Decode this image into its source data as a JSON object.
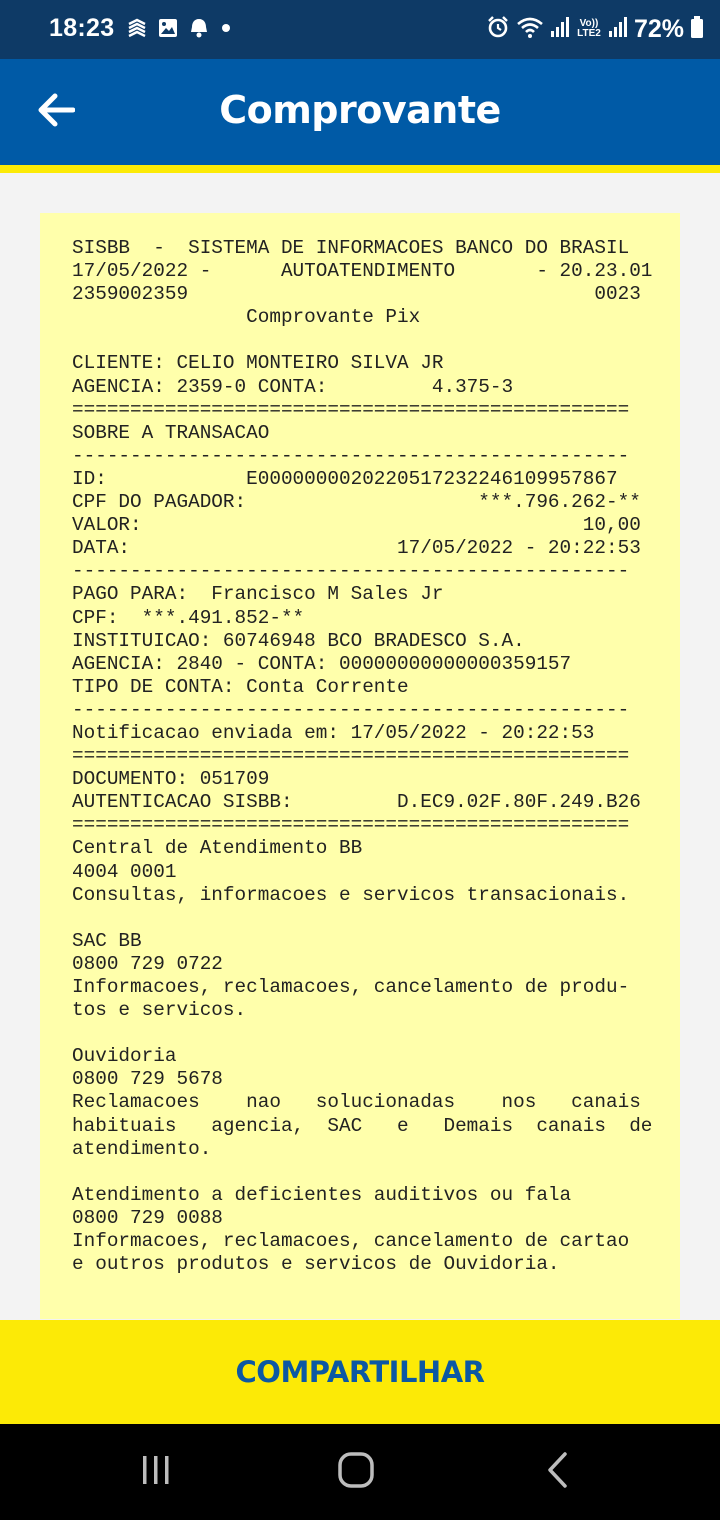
{
  "status_bar": {
    "time": "18:23",
    "battery": "72%",
    "left_icons": [
      "bb-logo-icon",
      "image-icon",
      "app-notification-icon",
      "dot-icon"
    ],
    "right_icons": [
      "alarm-icon",
      "wifi-icon",
      "signal-icon",
      "volte-icon",
      "signal-icon",
      "battery-icon"
    ],
    "volte_label": "Vo)) LTE2"
  },
  "app_bar": {
    "title": "Comprovante",
    "back_icon": "arrow-left-icon"
  },
  "receipt": {
    "lines": [
      "SISBB  -  SISTEMA DE INFORMACOES BANCO DO BRASIL",
      "17/05/2022 -      AUTOATENDIMENTO       - 20.23.01",
      "2359002359                                   0023",
      "               Comprovante Pix",
      "",
      "CLIENTE: CELIO MONTEIRO SILVA JR",
      "AGENCIA: 2359-0 CONTA:         4.375-3",
      "================================================",
      "SOBRE A TRANSACAO",
      "------------------------------------------------",
      "ID:            E00000000202205172322461099578​67",
      "CPF DO PAGADOR:                    ***.796.262-**",
      "VALOR:                                      10,00",
      "DATA:                       17/05/2022 - 20:22:53",
      "------------------------------------------------",
      "PAGO PARA:  Francisco M Sales Jr",
      "CPF:  ***.491.852-**",
      "INSTITUICAO: 60746948 BCO BRADESCO S.A.",
      "AGENCIA: 2840 - CONTA: 00000000000000359157",
      "TIPO DE CONTA: Conta Corrente",
      "------------------------------------------------",
      "Notificacao enviada em: 17/05/2022 - 20:22:53",
      "================================================",
      "DOCUMENTO: 051709",
      "AUTENTICACAO SISBB:         D.EC9.02F.80F.249.B26",
      "================================================",
      "Central de Atendimento BB",
      "4004 0001",
      "Consultas, informacoes e servicos transacionais.",
      "",
      "SAC BB",
      "0800 729 0722",
      "Informacoes, reclamacoes, cancelamento de produ-",
      "tos e servicos.",
      "",
      "Ouvidoria",
      "0800 729 5678",
      "Reclamacoes    nao   solucionadas    nos   canais",
      "habituais   agencia,  SAC   e   Demais  canais  de",
      "atendimento.",
      "",
      "Atendimento a deficientes auditivos ou fala",
      "0800 729 0088",
      "Informacoes, reclamacoes, cancelamento de cartao",
      "e outros produtos e servicos de Ouvidoria."
    ]
  },
  "share": {
    "label": "COMPARTILHAR"
  },
  "nav_bar": {
    "icons": [
      "recents-icon",
      "home-icon",
      "back-icon"
    ]
  },
  "colors": {
    "status_bar": "#0e3a66",
    "app_bar": "#005aa6",
    "accent_yellow": "#fcea06",
    "receipt_bg": "#ffffab",
    "share_text": "#0c58a3"
  }
}
